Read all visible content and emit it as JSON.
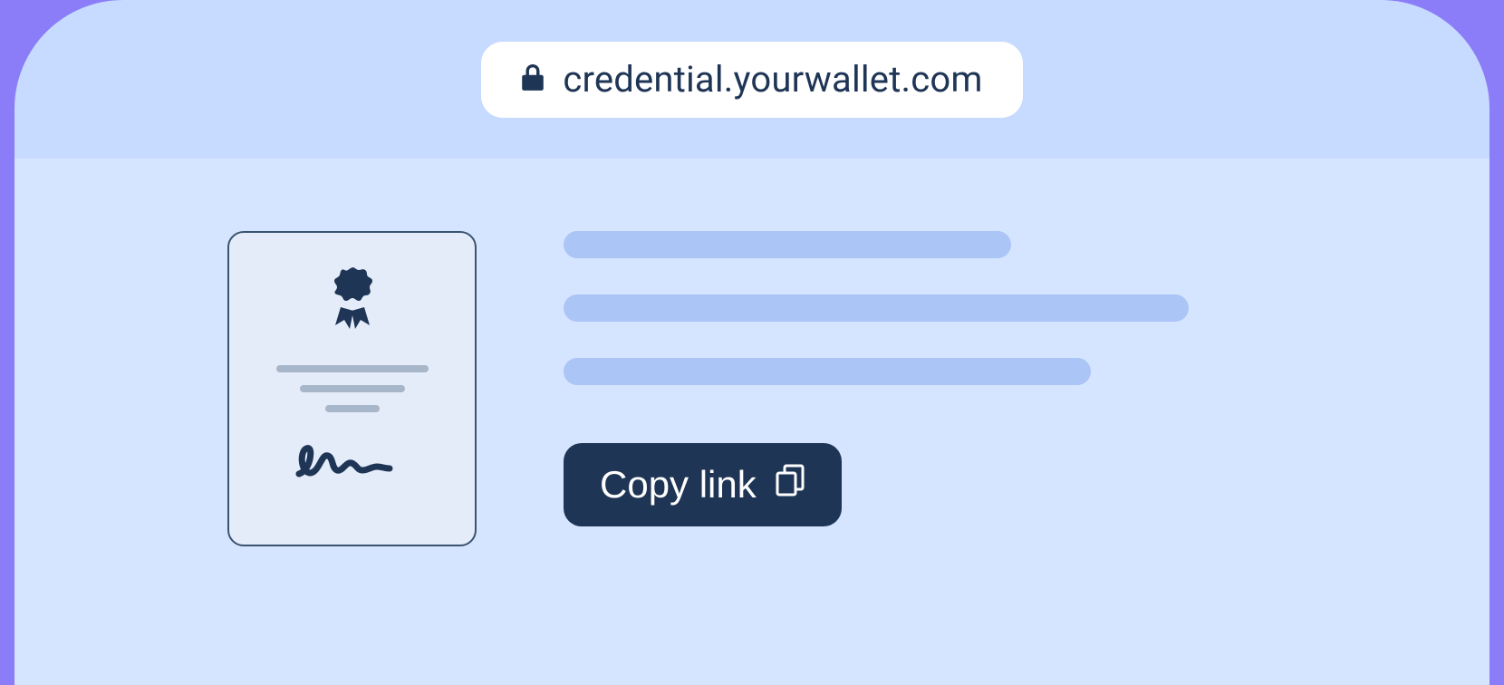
{
  "address_bar": {
    "url": "credential.yourwallet.com"
  },
  "actions": {
    "copy_link_label": "Copy link"
  },
  "colors": {
    "frame_outer": "#8b7cf7",
    "header_bg": "#c7daff",
    "content_bg": "#d6e5ff",
    "placeholder": "#abc5f6",
    "card_bg": "#e4ecfa",
    "card_border": "#3a5470",
    "dark": "#1f3556"
  }
}
